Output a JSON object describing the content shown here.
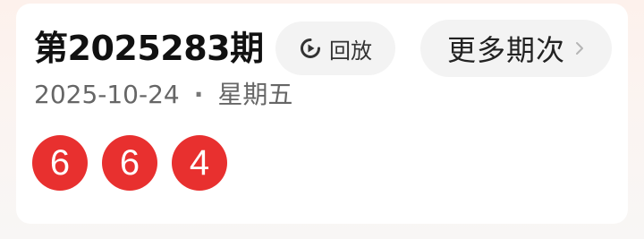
{
  "draw": {
    "issue_title": "第2025283期",
    "date": "2025-10-24",
    "separator": "·",
    "weekday": "星期五",
    "numbers": [
      "6",
      "6",
      "4"
    ]
  },
  "actions": {
    "replay_label": "回放",
    "replay_icon": "play-circle-icon",
    "more_label": "更多期次",
    "more_icon": "chevron-right-icon"
  },
  "colors": {
    "ball": "#e8302f",
    "button_bg": "#f3f3f3"
  }
}
